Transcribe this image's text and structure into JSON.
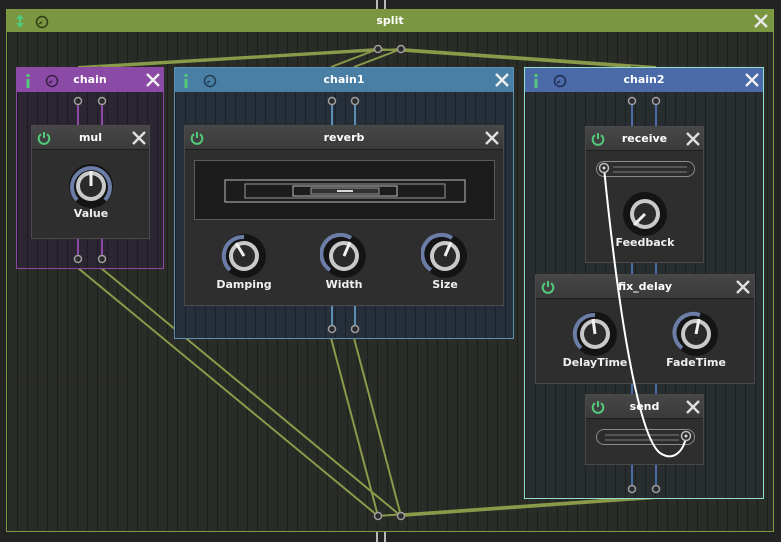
{
  "split": {
    "title": "split"
  },
  "chain": {
    "title": "chain",
    "mul": {
      "title": "mul",
      "knob_label": "Value"
    }
  },
  "chain1": {
    "title": "chain1",
    "reverb": {
      "title": "reverb",
      "knobs": [
        "Damping",
        "Width",
        "Size"
      ]
    }
  },
  "chain2": {
    "title": "chain2",
    "receive": {
      "title": "receive",
      "knob_label": "Feedback"
    },
    "fix_delay": {
      "title": "fix_delay",
      "knobs": [
        "DelayTime",
        "FadeTime"
      ]
    },
    "send": {
      "title": "send"
    }
  },
  "colors": {
    "split": "#7a9640",
    "chain": "#8a4aa6",
    "chain1": "#4a7fa5",
    "chain2": "#4a6aa8",
    "power": "#53c97a",
    "cable": "#8a9a4a"
  },
  "icons": [
    "bypass-icon",
    "clock-icon",
    "close-icon",
    "power-icon"
  ]
}
